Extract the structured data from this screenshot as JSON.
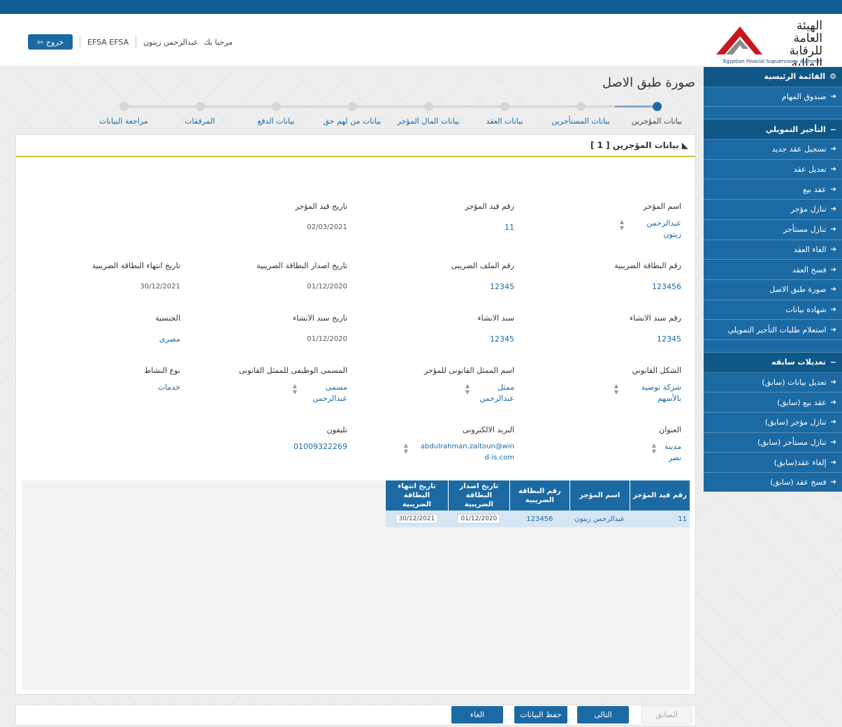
{
  "colors": {
    "primary": "#1c6aa3",
    "topbar": "#0e5d93",
    "accent_line": "#c8cc3a"
  },
  "header": {
    "logo_ar_line1": "الهيئة العامة",
    "logo_ar_line2": "للرقابة المالية",
    "logo_en": "Egyptian Finacial Supuervisory Authority",
    "greeting": "مرحبا بك",
    "user_name": "عبدالرحمن زيتون",
    "org": "EFSA EFSA",
    "logout_label": "خروج",
    "logout_icon": "sign-out-icon"
  },
  "sidebar": {
    "main_menu": "القائمة الرئيسية",
    "main_menu_icon": "gears-icon",
    "tasks": "صندوق المهام",
    "section1": "التأجير التمويلي",
    "section1_items": [
      "تسجيل عقد جديد",
      "تعديل عقد",
      "عقد بيع",
      "تنازل مؤجر",
      "تنازل مستأجر",
      "الغاء العقد",
      "فسخ العقد",
      "صورة طبق الاصل",
      "شهادة بيانات",
      "استعلام طلبات التأجير التمويلي"
    ],
    "section2": "تعديلات سابقه",
    "section2_items": [
      "تعديل بيانات (سابق)",
      "عقد بيع (سابق)",
      "تنازل مؤجر (سابق)",
      "تنازل مستأجر (سابق)",
      "إلغاء عقد(سابق)",
      "فسخ عقد (سابق)"
    ]
  },
  "page": {
    "title": "صورة طبق الاصل"
  },
  "steps": [
    "بيانات المؤجرين",
    "بيانات المستأجرين",
    "بيانات العقد",
    "بيانات المال المؤجر",
    "بيانات من لهم حق",
    "بيانات الدفع",
    "المرفقات",
    "مراجعة البيانات"
  ],
  "panel": {
    "heading": "بيانات المؤجرين [ 1 ]"
  },
  "fields": {
    "lessor_name_label": "اسم المؤجر",
    "lessor_name": "عبدالرحمن زيتون",
    "reg_no_label": "رقم قيد المؤجر",
    "reg_no": "11",
    "reg_date_label": "تاريخ قيد المؤجر",
    "reg_date": "02/03/2021",
    "tax_card_label": "رقم البطاقة الضريبية",
    "tax_card": "123456",
    "tax_file_label": "رقم الملف الضريبى",
    "tax_file": "12345",
    "tax_issue_label": "تاريخ اصدار البطاقة الضريبية",
    "tax_issue": "01/12/2020",
    "tax_expiry_label": "تاريخ انتهاء البطاقة الضريبية",
    "tax_expiry": "30/12/2021",
    "est_no_label": "رقم سند الانشاء",
    "est_no": "12345",
    "est_doc_label": "سند الانشاء",
    "est_doc": "12345",
    "est_date_label": "تاريخ سند الانشاء",
    "est_date": "01/12/2020",
    "nationality_label": "الجنسية",
    "nationality": "مصرى",
    "legal_form_label": "الشكل القانوني",
    "legal_form": "شركة توصية بالأسهم",
    "legal_rep_label": "اسم الممثل القانونى للمؤجر",
    "legal_rep": "ممثل عبدالرحمن",
    "rep_title_label": "المسمى الوظيفى للممثل القانونى",
    "rep_title": "مسمى عبدالرحمن",
    "activity_label": "نوع النشاط",
    "activity": "خدمات",
    "address_label": "العنوان",
    "address": "مدينة نصر",
    "email_label": "البريد الالكترونى",
    "email": "abdulrahman.zaitoun@wind-is.com",
    "phone_label": "تليفون",
    "phone": "01009322269"
  },
  "grid": {
    "headers": [
      "رقم قيد المؤجر",
      "اسم المؤجر",
      "رقم البطاقة الضريبية",
      "تاريخ اصدار البطاقة الضريبية",
      "تاريخ انتهاء البطاقة الضريبية"
    ],
    "rows": [
      [
        "11",
        "عبدالرحمن زيتون",
        "123456",
        "01/12/2020",
        "30/12/2021"
      ]
    ]
  },
  "footer": {
    "prev": "السابق",
    "next": "التالى",
    "save": "حفظ البيانات",
    "cancel": "الغاء"
  }
}
